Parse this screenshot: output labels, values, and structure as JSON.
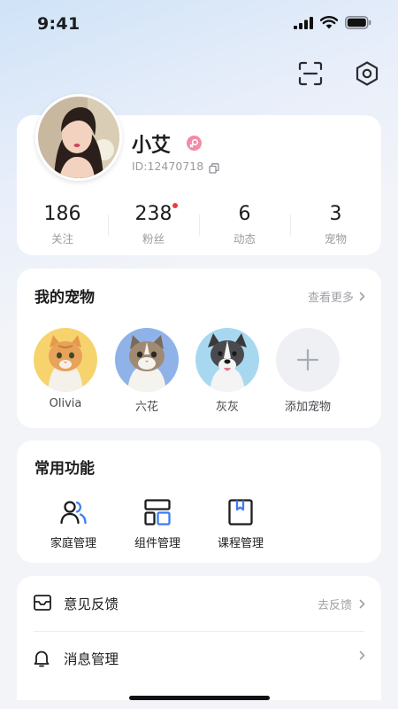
{
  "status_bar": {
    "time": "9:41"
  },
  "topbar": {
    "icons": [
      "scan-icon",
      "settings-hexagon-icon"
    ]
  },
  "profile": {
    "name": "小艾",
    "user_id": "ID:12470718",
    "gender_icon": "female-icon",
    "gender_color": "#f28ba8",
    "stats": [
      {
        "value": "186",
        "label": "关注",
        "has_dot": false
      },
      {
        "value": "238",
        "label": "粉丝",
        "has_dot": true
      },
      {
        "value": "6",
        "label": "动态",
        "has_dot": false
      },
      {
        "value": "3",
        "label": "宠物",
        "has_dot": false
      }
    ]
  },
  "pets": {
    "title": "我的宠物",
    "more": "查看更多",
    "items": [
      {
        "name": "Olivia",
        "bg": "#f7d36e"
      },
      {
        "name": "六花",
        "bg": "#8fb2e8"
      },
      {
        "name": "灰灰",
        "bg": "#a8d8f0"
      },
      {
        "name": "添加宠物",
        "bg": "#eef0f4"
      }
    ]
  },
  "functions": {
    "title": "常用功能",
    "items": [
      {
        "label": "家庭管理",
        "icon": "family-icon"
      },
      {
        "label": "组件管理",
        "icon": "widget-icon"
      },
      {
        "label": "课程管理",
        "icon": "course-icon"
      }
    ],
    "accent": "#3b7cf6"
  },
  "menu": [
    {
      "label": "意见反馈",
      "right": "去反馈",
      "icon": "mail-icon"
    },
    {
      "label": "消息管理",
      "right": "",
      "icon": "bell-icon"
    }
  ]
}
